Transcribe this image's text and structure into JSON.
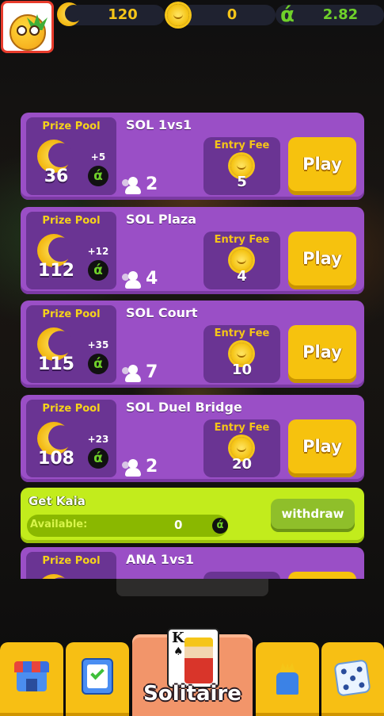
{
  "header": {
    "moons": "120",
    "suns": "0",
    "kaia": "2.82",
    "kaia_symbol": "࿑"
  },
  "kaia_symbol": "ά",
  "games": [
    {
      "title": "SOL 1vs1",
      "pool_label": "Prize Pool",
      "pool": "36",
      "bonus": "+5",
      "players": "2",
      "fee_label": "Entry Fee",
      "fee": "5",
      "play": "Play"
    },
    {
      "title": "SOL Plaza",
      "pool_label": "Prize Pool",
      "pool": "112",
      "bonus": "+12",
      "players": "4",
      "fee_label": "Entry Fee",
      "fee": "4",
      "play": "Play"
    },
    {
      "title": "SOL Court",
      "pool_label": "Prize Pool",
      "pool": "115",
      "bonus": "+35",
      "players": "7",
      "fee_label": "Entry Fee",
      "fee": "10",
      "play": "Play"
    },
    {
      "title": "SOL Duel Bridge",
      "pool_label": "Prize Pool",
      "pool": "108",
      "bonus": "+23",
      "players": "2",
      "fee_label": "Entry Fee",
      "fee": "20",
      "play": "Play"
    }
  ],
  "kaia_panel": {
    "title": "Get Kaia",
    "available_label": "Available:",
    "available_value": "0",
    "withdraw": "withdraw"
  },
  "partial_game": {
    "pool_label": "Prize Pool",
    "title": "ANA 1vs1"
  },
  "nav": {
    "center_label": "Solitaire",
    "card_rank": "K",
    "card_suit": "♠"
  },
  "colors": {
    "card_purple": "#9a4fc6",
    "pool_purple": "#6a3493",
    "play_yellow": "#f6c20e",
    "kaia_green": "#c2ec1c",
    "nav_yellow": "#f7bf14",
    "nav_center": "#f2956a"
  }
}
